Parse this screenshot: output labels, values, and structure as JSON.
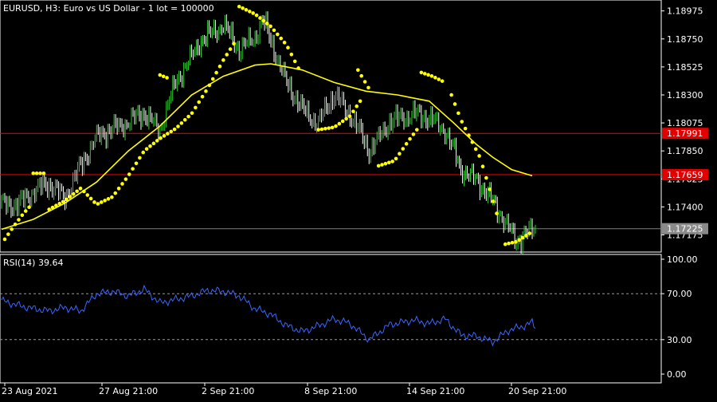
{
  "window": {
    "main_title": "EURUSD, H3:  Euro vs US Dollar - 1 lot = 100000",
    "indicator_title": "RSI(14) 39.64"
  },
  "colors": {
    "background": "#000000",
    "axis": "#ffffff",
    "bull": "#33cc33",
    "bear": "#ffffff",
    "sar": "#ffff00",
    "ma": "#ffff00",
    "hline": "#ff0000",
    "bid_line": "#808080",
    "rsi": "#3a66ff",
    "level_line": "#9a9a9a",
    "red_label": "#e00000",
    "bid_label": "#8a8a8a"
  },
  "chart_data": [
    {
      "type": "candlestick",
      "symbol": "EURUSD",
      "timeframe": "H3",
      "ylim": [
        1.1705,
        1.1905
      ],
      "y_ticks": [
        "1.18975",
        "1.18750",
        "1.18525",
        "1.18300",
        "1.18075",
        "1.17850",
        "1.17625",
        "1.17400",
        "1.17175"
      ],
      "x_labels": [
        "23 Aug 2021",
        "27 Aug 21:00",
        "2 Sep 21:00",
        "8 Sep 21:00",
        "14 Sep 21:00",
        "20 Sep 21:00"
      ],
      "horizontal_lines": [
        {
          "label": "1.17991",
          "value": 1.17991,
          "kind": "level"
        },
        {
          "label": "1.17659",
          "value": 1.17659,
          "kind": "level"
        },
        {
          "label": "1.17225",
          "value": 1.17225,
          "kind": "bid"
        }
      ],
      "close_anchors": [
        [
          0,
          1.1743
        ],
        [
          10,
          1.1741
        ],
        [
          20,
          1.1753
        ],
        [
          30,
          1.1758
        ],
        [
          40,
          1.1748
        ],
        [
          60,
          1.1797
        ],
        [
          70,
          1.1802
        ],
        [
          90,
          1.1815
        ],
        [
          100,
          1.1802
        ],
        [
          110,
          1.184
        ],
        [
          125,
          1.1872
        ],
        [
          140,
          1.1887
        ],
        [
          150,
          1.1866
        ],
        [
          160,
          1.1877
        ],
        [
          165,
          1.189
        ],
        [
          180,
          1.184
        ],
        [
          190,
          1.1818
        ],
        [
          200,
          1.1808
        ],
        [
          210,
          1.183
        ],
        [
          220,
          1.1815
        ],
        [
          232,
          1.1785
        ],
        [
          245,
          1.1808
        ],
        [
          260,
          1.1815
        ],
        [
          272,
          1.181
        ],
        [
          280,
          1.1802
        ],
        [
          290,
          1.177
        ],
        [
          300,
          1.1762
        ],
        [
          315,
          1.1735
        ],
        [
          325,
          1.1712
        ],
        [
          337,
          1.1724
        ]
      ],
      "moving_average": [
        [
          0,
          1.1722
        ],
        [
          20,
          1.173
        ],
        [
          40,
          1.1743
        ],
        [
          60,
          1.176
        ],
        [
          80,
          1.1785
        ],
        [
          100,
          1.1805
        ],
        [
          120,
          1.183
        ],
        [
          140,
          1.1845
        ],
        [
          160,
          1.1854
        ],
        [
          170,
          1.1855
        ],
        [
          190,
          1.185
        ],
        [
          210,
          1.184
        ],
        [
          230,
          1.1833
        ],
        [
          250,
          1.183
        ],
        [
          270,
          1.1825
        ],
        [
          285,
          1.1808
        ],
        [
          300,
          1.179
        ],
        [
          310,
          1.178
        ],
        [
          322,
          1.177
        ],
        [
          335,
          1.1765
        ]
      ],
      "parabolic_sar": [
        [
          [
            2,
            1.1714
          ],
          [
            8,
            1.1725
          ],
          [
            14,
            1.1735
          ],
          [
            19,
            1.1742
          ]
        ],
        [
          [
            20,
            1.1767
          ],
          [
            27,
            1.1767
          ]
        ],
        [
          [
            30,
            1.1738
          ],
          [
            40,
            1.1745
          ],
          [
            50,
            1.1755
          ],
          [
            60,
            1.1742
          ],
          [
            70,
            1.1748
          ],
          [
            80,
            1.1765
          ],
          [
            90,
            1.1785
          ],
          [
            100,
            1.1795
          ],
          [
            110,
            1.1803
          ],
          [
            120,
            1.1815
          ],
          [
            130,
            1.1835
          ],
          [
            140,
            1.1858
          ],
          [
            148,
            1.1874
          ]
        ],
        [
          [
            100,
            1.1846
          ],
          [
            106,
            1.1843
          ]
        ],
        [
          [
            150,
            1.1901
          ],
          [
            160,
            1.1895
          ],
          [
            170,
            1.1885
          ],
          [
            180,
            1.187
          ],
          [
            188,
            1.185
          ]
        ],
        [
          [
            200,
            1.1802
          ],
          [
            210,
            1.1804
          ],
          [
            220,
            1.1813
          ],
          [
            228,
            1.1828
          ]
        ],
        [
          [
            225,
            1.185
          ],
          [
            232,
            1.1835
          ]
        ],
        [
          [
            238,
            1.1773
          ],
          [
            248,
            1.1777
          ],
          [
            258,
            1.1795
          ],
          [
            264,
            1.1805
          ]
        ],
        [
          [
            265,
            1.1848
          ],
          [
            272,
            1.1845
          ],
          [
            280,
            1.184
          ]
        ],
        [
          [
            284,
            1.183
          ],
          [
            290,
            1.181
          ],
          [
            296,
            1.1795
          ],
          [
            302,
            1.178
          ],
          [
            308,
            1.1755
          ],
          [
            313,
            1.1733
          ]
        ],
        [
          [
            318,
            1.171
          ],
          [
            325,
            1.1712
          ],
          [
            330,
            1.1716
          ],
          [
            335,
            1.172
          ]
        ]
      ]
    },
    {
      "type": "line",
      "name": "RSI(14)",
      "ylim": [
        0,
        100
      ],
      "y_ticks": [
        "100.00",
        "70.00",
        "30.00",
        "0.00"
      ],
      "levels": [
        70,
        30
      ],
      "last_value": 39.64,
      "values": [
        [
          0,
          64
        ],
        [
          10,
          60
        ],
        [
          20,
          57
        ],
        [
          30,
          55
        ],
        [
          40,
          58
        ],
        [
          50,
          55
        ],
        [
          60,
          70
        ],
        [
          70,
          72
        ],
        [
          80,
          68
        ],
        [
          90,
          74
        ],
        [
          100,
          62
        ],
        [
          110,
          65
        ],
        [
          120,
          68
        ],
        [
          130,
          73
        ],
        [
          140,
          72
        ],
        [
          150,
          68
        ],
        [
          160,
          57
        ],
        [
          170,
          52
        ],
        [
          180,
          42
        ],
        [
          190,
          37
        ],
        [
          200,
          42
        ],
        [
          210,
          48
        ],
        [
          220,
          44
        ],
        [
          232,
          30
        ],
        [
          245,
          43
        ],
        [
          260,
          47
        ],
        [
          270,
          44
        ],
        [
          280,
          48
        ],
        [
          290,
          34
        ],
        [
          300,
          33
        ],
        [
          310,
          28
        ],
        [
          320,
          38
        ],
        [
          330,
          42
        ],
        [
          335,
          45
        ],
        [
          337,
          39.64
        ]
      ]
    }
  ]
}
